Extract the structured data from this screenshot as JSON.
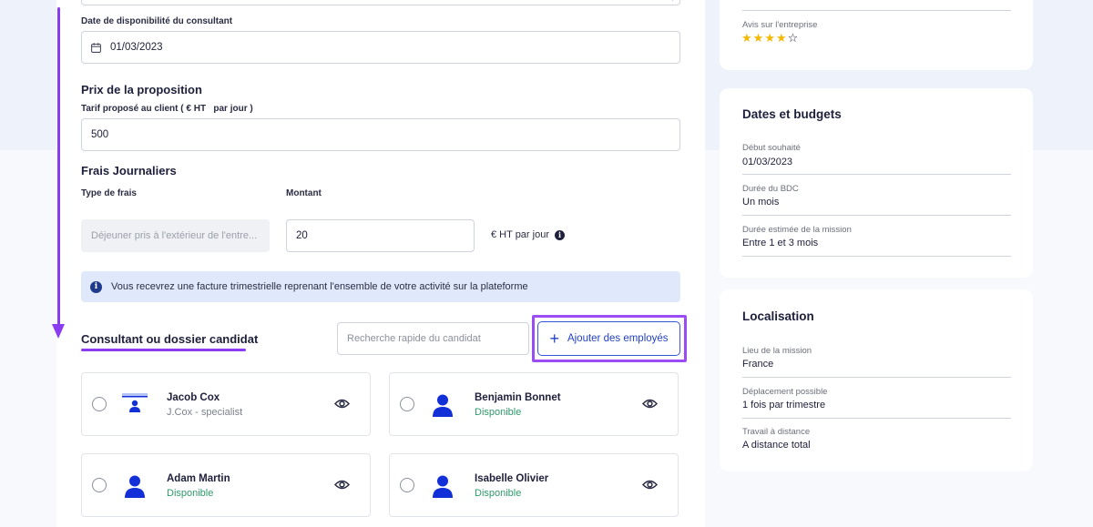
{
  "form": {
    "availability_label": "Date de disponibilité du consultant",
    "availability_value": "01/03/2023",
    "price_title": "Prix de la proposition",
    "price_label": "Tarif proposé au client ( € HT   par jour )",
    "price_value": "500",
    "fees_title": "Frais Journaliers",
    "fee_type_label": "Type de frais",
    "amount_label": "Montant",
    "fee_type_value": "Déjeuner pris à l'extérieur de l'entre...",
    "amount_value": "20",
    "amount_unit": "€ HT par jour",
    "info_icon": "i",
    "info_banner": "Vous recevrez une facture trimestrielle reprenant l'ensemble de votre activité sur la plateforme"
  },
  "candidates": {
    "title": "Consultant ou dossier candidat",
    "search_placeholder": "Recherche rapide du candidat",
    "add_button_icon": "+",
    "add_button_label": "Ajouter des employés",
    "list": [
      {
        "name": "Jacob Cox",
        "status": "J.Cox - specialist"
      },
      {
        "name": "Benjamin Bonnet",
        "status": "Disponible"
      },
      {
        "name": "Adam Martin",
        "status": "Disponible"
      },
      {
        "name": "Isabelle Olivier",
        "status": "Disponible"
      }
    ]
  },
  "sidebar": {
    "company": {
      "rating_label": "Avis sur l'entreprise",
      "rating": 4,
      "rating_max": 5
    },
    "dates": {
      "title": "Dates et budgets",
      "start_label": "Début souhaité",
      "start_value": "01/03/2023",
      "duration_label": "Durée du BDC",
      "duration_value": "Un mois",
      "estimated_label": "Durée estimée de la mission",
      "estimated_value": "Entre 1 et 3 mois"
    },
    "location": {
      "title": "Localisation",
      "place_label": "Lieu de la mission",
      "place_value": "France",
      "travel_label": "Déplacement possible",
      "travel_value": "1 fois par trimestre",
      "remote_label": "Travail à distance",
      "remote_value": "A distance total"
    }
  },
  "colors": {
    "accent_purple": "#8b3cf2",
    "primary_blue": "#2342c5",
    "avatar_blue": "#1330d8",
    "available_green": "#2e9a6a",
    "star_yellow": "#f5b800"
  }
}
